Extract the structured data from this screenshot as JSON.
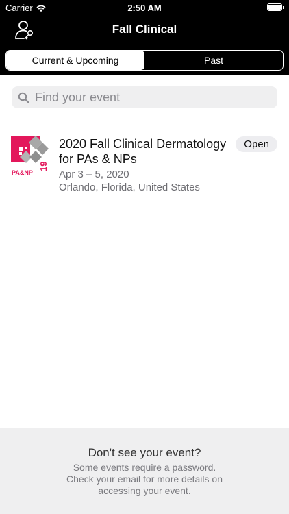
{
  "status_bar": {
    "carrier": "Carrier",
    "time": "2:50 AM"
  },
  "nav": {
    "title": "Fall Clinical",
    "login_icon": "user-key-icon"
  },
  "segments": {
    "current": "Current & Upcoming",
    "past": "Past",
    "selected": "current"
  },
  "search": {
    "placeholder": "Find your event",
    "value": ""
  },
  "events": [
    {
      "title": "2020 Fall Clinical Dermatology for PAs & NPs",
      "dates": "Apr 3 – 5, 2020",
      "location": "Orlando, Florida, United States",
      "status": "Open",
      "logo": {
        "text": "PA&NP",
        "number": "19",
        "accent_color": "#e3175b",
        "secondary_color": "#9a9a9a"
      }
    }
  ],
  "footer": {
    "title": "Don't see your event?",
    "body": "Some events require a password. Check your email for more details on accessing your event."
  },
  "colors": {
    "nav_background": "#000000",
    "search_background": "#efeff0",
    "footer_background": "#efeff0",
    "secondary_text": "#6e6e73"
  }
}
